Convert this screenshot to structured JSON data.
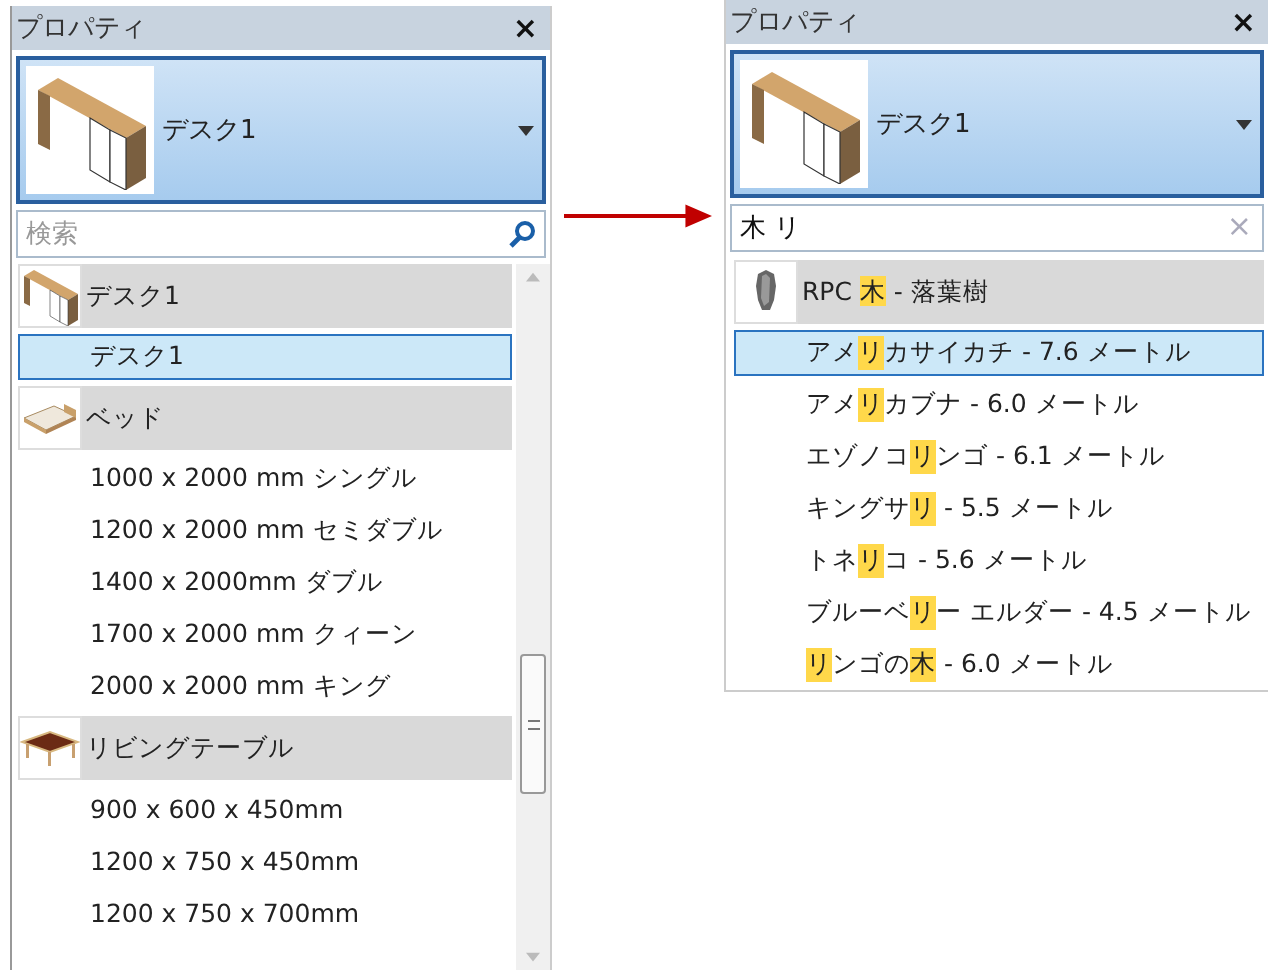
{
  "left_panel": {
    "title": "プロパティ",
    "close": "×",
    "selector": {
      "name": "デスク1"
    },
    "search": {
      "placeholder": "検索"
    },
    "list": [
      {
        "kind": "group",
        "label": "デスク1"
      },
      {
        "kind": "item",
        "label": "デスク1",
        "selected": true
      },
      {
        "kind": "group",
        "label": "ベッド"
      },
      {
        "kind": "item",
        "label": "1000 x 2000 mm シングル",
        "selected": false
      },
      {
        "kind": "item",
        "label": "1200 x 2000 mm セミダブル",
        "selected": false
      },
      {
        "kind": "item",
        "label": "1400 x 2000mm ダブル",
        "selected": false
      },
      {
        "kind": "item",
        "label": "1700 x 2000 mm クィーン",
        "selected": false
      },
      {
        "kind": "item",
        "label": "2000 x 2000 mm キング",
        "selected": false
      },
      {
        "kind": "group",
        "label": "リビングテーブル"
      },
      {
        "kind": "item",
        "label": "900 x 600 x 450mm",
        "selected": false
      },
      {
        "kind": "item",
        "label": "1200 x 750 x 450mm",
        "selected": false
      },
      {
        "kind": "item",
        "label": "1200 x 750 x 700mm",
        "selected": false
      }
    ]
  },
  "right_panel": {
    "title": "プロパティ",
    "close": "×",
    "selector": {
      "name": "デスク1"
    },
    "search": {
      "value": "木 リ"
    },
    "clear": "×",
    "list": [
      {
        "kind": "group",
        "segments": [
          {
            "text": "RPC ",
            "highlighted": false
          },
          {
            "text": "木",
            "highlighted": true
          },
          {
            "text": " - 落葉樹",
            "highlighted": false
          }
        ]
      },
      {
        "kind": "item",
        "selected": true,
        "segments": [
          {
            "text": "アメ",
            "highlighted": false
          },
          {
            "text": "リ",
            "highlighted": true
          },
          {
            "text": "カサイカチ - 7.6 メートル",
            "highlighted": false
          }
        ]
      },
      {
        "kind": "item",
        "selected": false,
        "segments": [
          {
            "text": "アメ",
            "highlighted": false
          },
          {
            "text": "リ",
            "highlighted": true
          },
          {
            "text": "カブナ - 6.0 メートル",
            "highlighted": false
          }
        ]
      },
      {
        "kind": "item",
        "selected": false,
        "segments": [
          {
            "text": "エゾノコ",
            "highlighted": false
          },
          {
            "text": "リ",
            "highlighted": true
          },
          {
            "text": "ンゴ - 6.1 メートル",
            "highlighted": false
          }
        ]
      },
      {
        "kind": "item",
        "selected": false,
        "segments": [
          {
            "text": "キングサ",
            "highlighted": false
          },
          {
            "text": "リ",
            "highlighted": true
          },
          {
            "text": " - 5.5 メートル",
            "highlighted": false
          }
        ]
      },
      {
        "kind": "item",
        "selected": false,
        "segments": [
          {
            "text": "トネ",
            "highlighted": false
          },
          {
            "text": "リ",
            "highlighted": true
          },
          {
            "text": "コ - 5.6 メートル",
            "highlighted": false
          }
        ]
      },
      {
        "kind": "item",
        "selected": false,
        "segments": [
          {
            "text": "ブルーベ",
            "highlighted": false
          },
          {
            "text": "リ",
            "highlighted": true
          },
          {
            "text": "ー エルダー - 4.5 メートル",
            "highlighted": false
          }
        ]
      },
      {
        "kind": "item",
        "selected": false,
        "segments": [
          {
            "text": "リ",
            "highlighted": true
          },
          {
            "text": "ンゴの",
            "highlighted": false
          },
          {
            "text": "木",
            "highlighted": true
          },
          {
            "text": " - 6.0 メートル",
            "highlighted": false
          }
        ]
      }
    ]
  }
}
